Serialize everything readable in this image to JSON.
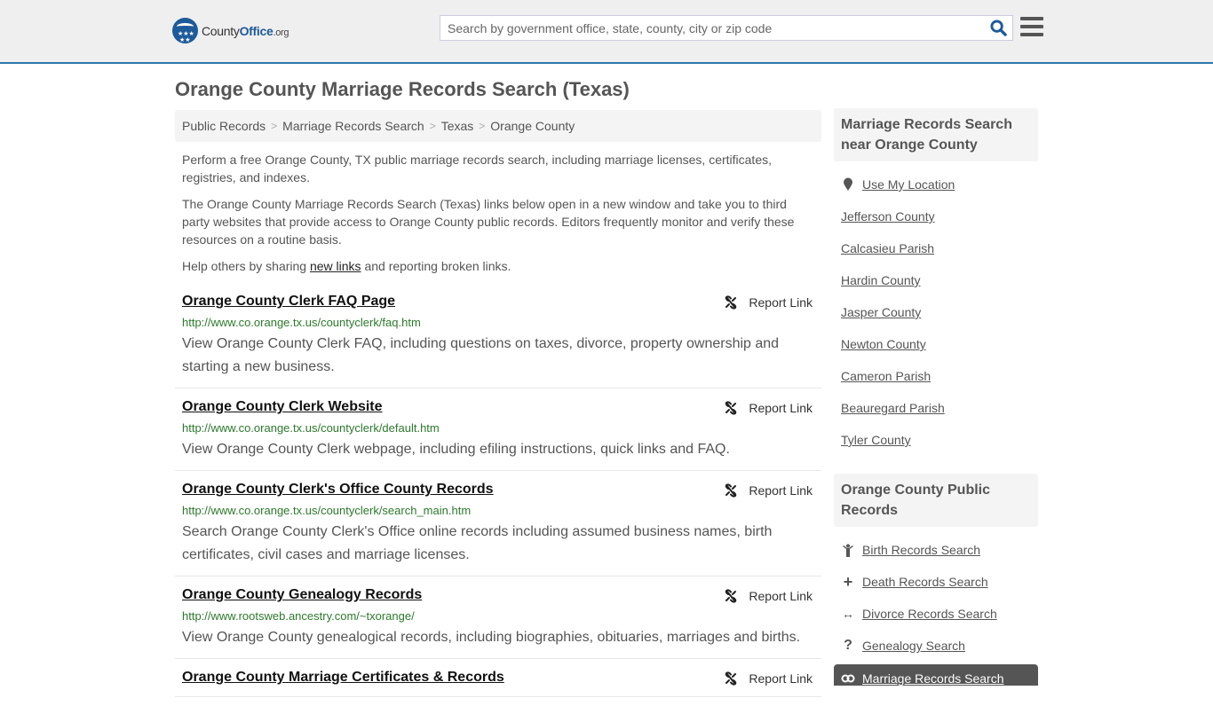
{
  "header": {
    "logo": {
      "part1": "County",
      "part2": "Office",
      "part3": ".org"
    },
    "search_placeholder": "Search by government office, state, county, city or zip code",
    "search_value": "",
    "accent_color": "#2f77ad"
  },
  "page": {
    "title": "Orange County Marriage Records Search (Texas)"
  },
  "breadcrumb": [
    {
      "label": "Public Records"
    },
    {
      "label": "Marriage Records Search"
    },
    {
      "label": "Texas"
    },
    {
      "label": "Orange County"
    }
  ],
  "intro": {
    "p1": "Perform a free Orange County, TX public marriage records search, including marriage licenses, certificates, registries, and indexes.",
    "p2": "The Orange County Marriage Records Search (Texas) links below open in a new window and take you to third party websites that provide access to Orange County public records. Editors frequently monitor and verify these resources on a routine basis.",
    "p3_before": "Help others by sharing ",
    "p3_link": "new links",
    "p3_after": " and reporting broken links."
  },
  "report_label": "Report Link",
  "results": [
    {
      "title": "Orange County Clerk FAQ Page",
      "url": "http://www.co.orange.tx.us/countyclerk/faq.htm",
      "desc": "View Orange County Clerk FAQ, including questions on taxes, divorce, property ownership and starting a new business."
    },
    {
      "title": "Orange County Clerk Website",
      "url": "http://www.co.orange.tx.us/countyclerk/default.htm",
      "desc": "View Orange County Clerk webpage, including efiling instructions, quick links and FAQ."
    },
    {
      "title": "Orange County Clerk's Office County Records",
      "url": "http://www.co.orange.tx.us/countyclerk/search_main.htm",
      "desc": "Search Orange County Clerk's Office online records including assumed business names, birth certificates, civil cases and marriage licenses."
    },
    {
      "title": "Orange County Genealogy Records",
      "url": "http://www.rootsweb.ancestry.com/~txorange/",
      "desc": "View Orange County genealogical records, including biographies, obituaries, marriages and births."
    },
    {
      "title": "Orange County Marriage Certificates & Records",
      "url": "",
      "desc": ""
    }
  ],
  "sidebar": {
    "nearby_heading": "Marriage Records Search near Orange County",
    "use_location": "Use My Location",
    "nearby": [
      "Jefferson County",
      "Calcasieu Parish",
      "Hardin County",
      "Jasper County",
      "Newton County",
      "Cameron Parish",
      "Beauregard Parish",
      "Tyler County"
    ],
    "public_heading": "Orange County Public Records",
    "public_records": [
      {
        "label": "Birth Records Search",
        "icon": "child-icon"
      },
      {
        "label": "Death Records Search",
        "icon": "cross-icon"
      },
      {
        "label": "Divorce Records Search",
        "icon": "arrows-horizontal-icon"
      },
      {
        "label": "Genealogy Search",
        "icon": "question-icon"
      }
    ],
    "active_item": {
      "label": "Marriage Records Search",
      "icon": "rings-icon"
    }
  }
}
